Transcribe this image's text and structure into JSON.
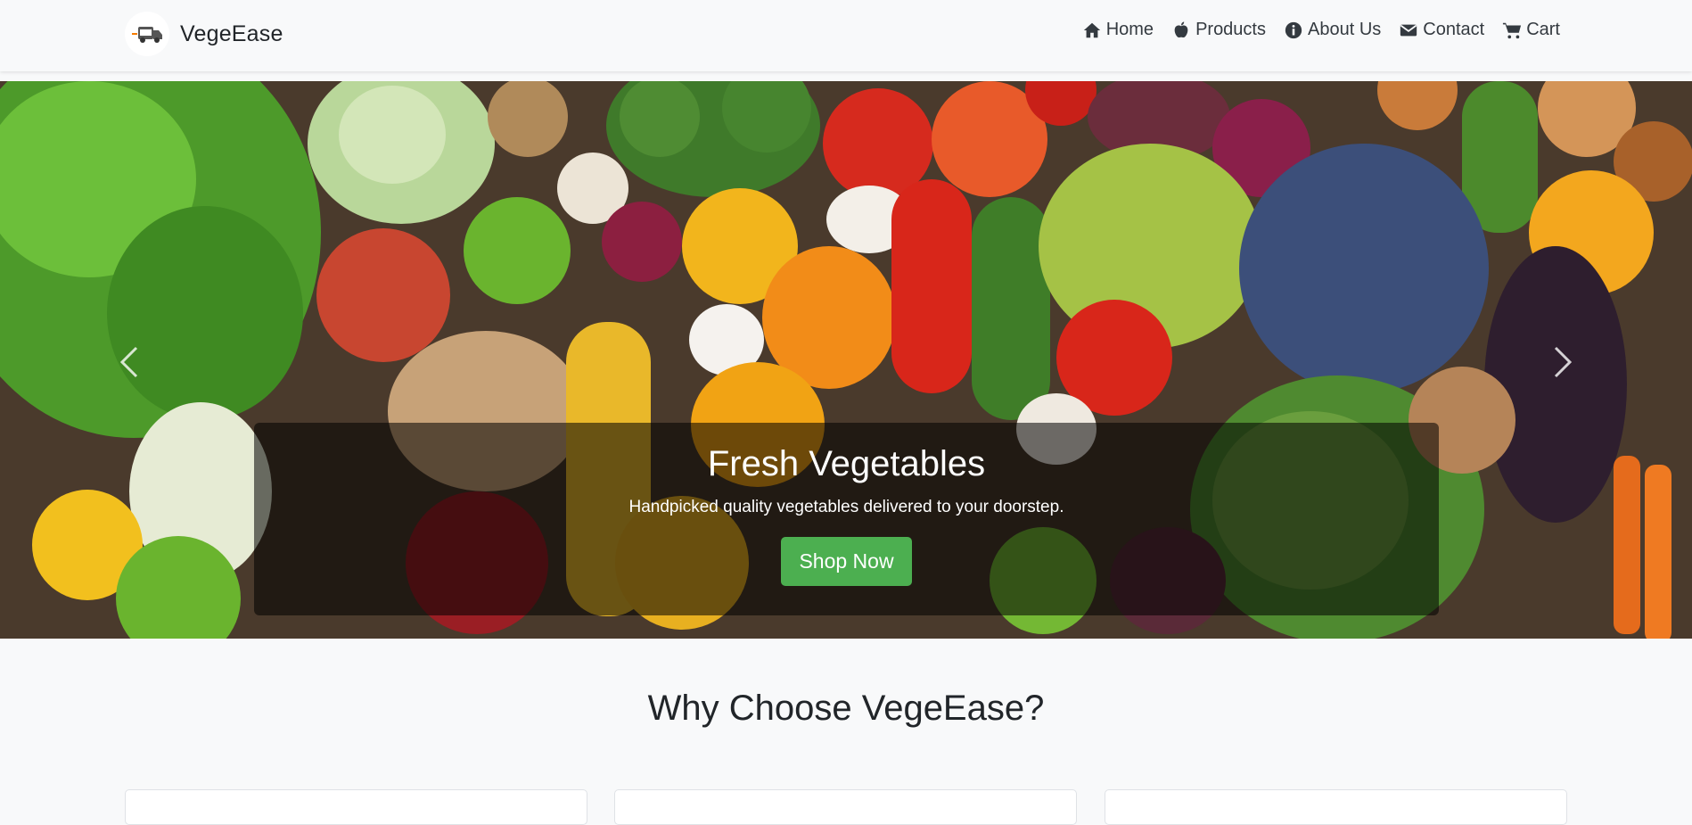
{
  "brand": {
    "name": "VegeEase",
    "logo_icon": "delivery-truck-logo"
  },
  "nav": {
    "items": [
      {
        "label": "Home",
        "icon": "home-icon"
      },
      {
        "label": "Products",
        "icon": "apple-icon"
      },
      {
        "label": "About Us",
        "icon": "info-icon"
      },
      {
        "label": "Contact",
        "icon": "envelope-icon"
      },
      {
        "label": "Cart",
        "icon": "cart-icon"
      }
    ]
  },
  "hero": {
    "title": "Fresh Vegetables",
    "subtitle": "Handpicked quality vegetables delivered to your doorstep.",
    "button_label": "Shop Now",
    "controls": {
      "prev_icon": "chevron-left-icon",
      "next_icon": "chevron-right-icon"
    }
  },
  "why": {
    "title": "Why Choose VegeEase?"
  },
  "colors": {
    "accent": "#4caf50",
    "navbar_bg": "#f8f9fa",
    "text": "#212529"
  }
}
